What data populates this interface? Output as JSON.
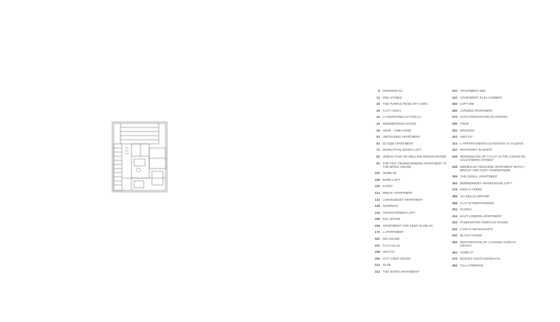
{
  "left_column": [
    {
      "page": "8",
      "title": "INTERIOR D2"
    },
    {
      "page": "12",
      "title": "MINI STUDIO"
    },
    {
      "page": "20",
      "title": "THE PURPLE ROSE OF CAIRO"
    },
    {
      "page": "28",
      "title": "FLAT 710N-1"
    },
    {
      "page": "34",
      "title": "LA MANSARDA DI STELLA"
    },
    {
      "page": "40",
      "title": "SHERBROOKE HOUSE"
    },
    {
      "page": "46",
      "title": "H8AR – ONE HOME"
    },
    {
      "page": "54",
      "title": "UNFOLDING APARTMENT"
    },
    {
      "page": "64",
      "title": "40 SQM APARTMENT"
    },
    {
      "page": "72",
      "title": "MANHATTAN MICRO LOFT"
    },
    {
      "page": "82",
      "title": "URBAN TAKE ON MELLOW MONOCHROME"
    },
    {
      "page": "92",
      "title": "THE TINY TRANSFORMING APARTMENT IN THE BRICK HOUSE"
    },
    {
      "page": "100",
      "title": "HOME 08"
    },
    {
      "page": "108",
      "title": "BARN LOFT"
    },
    {
      "page": "118",
      "title": "G-ROC"
    },
    {
      "page": "124",
      "title": "BREAK APARTMENT"
    },
    {
      "page": "132",
      "title": "LOW-BUDGET APARTMENT"
    },
    {
      "page": "138",
      "title": "SOSPESO"
    },
    {
      "page": "144",
      "title": "TRANSFORMER LOFT"
    },
    {
      "page": "158",
      "title": "SAL HOUSE"
    },
    {
      "page": "166",
      "title": "APARTMENT FOR RENT IN MILAN"
    },
    {
      "page": "176",
      "title": "L APARTMENT"
    },
    {
      "page": "182",
      "title": "IES HOUSE"
    },
    {
      "page": "190",
      "title": "FLAT VILAS"
    },
    {
      "page": "198",
      "title": "UNIT #2"
    },
    {
      "page": "206",
      "title": "CITY VIEW HOUSE"
    },
    {
      "page": "214",
      "title": "SLAB"
    },
    {
      "page": "224",
      "title": "THE WHITE APARTMENT"
    }
  ],
  "right_column": [
    {
      "page": "234",
      "title": "APARTMENT-26D"
    },
    {
      "page": "242",
      "title": "APARTMENT IN EL CARMEN"
    },
    {
      "page": "250",
      "title": "LOFT MM"
    },
    {
      "page": "260",
      "title": "JARDINS APARTMENT"
    },
    {
      "page": "270",
      "title": "ATTIC RENOVATION IN VERONA"
    },
    {
      "page": "280",
      "title": "FÖHR"
    },
    {
      "page": "294",
      "title": "EROSION"
    },
    {
      "page": "304",
      "title": "SWITCH"
    },
    {
      "page": "314",
      "title": "L'APPARTAMENTO DI MARTINA E VALERIO"
    },
    {
      "page": "322",
      "title": "RHAPSODY IN WHITE"
    },
    {
      "page": "338",
      "title": "REMODELING OF A FLAT IN THE COMTE DE SALVATIERRA STREET"
    },
    {
      "page": "348",
      "title": "MINIMALIST MOSCOW APARTMENT WITH A BRIGHT AND COZY ATMOSPHERE"
    },
    {
      "page": "356",
      "title": "THE OXHILL APARTMENT"
    },
    {
      "page": "364",
      "title": "BERMONDSEY WAREHOUSE LOFT"
    },
    {
      "page": "376",
      "title": "PIED-À-TERRE"
    },
    {
      "page": "388",
      "title": "VIA DELLE ORFANE"
    },
    {
      "page": "398",
      "title": "FLAT IN MONTEVERDE"
    },
    {
      "page": "404",
      "title": "GLORIA"
    },
    {
      "page": "414",
      "title": "EAST LONDON APARTMENT"
    },
    {
      "page": "424",
      "title": "PADDINGTON TERRACE HOUSE"
    },
    {
      "page": "432",
      "title": "CASA CAMAGHIAHO'S"
    },
    {
      "page": "442",
      "title": "BLACK HOUSE"
    },
    {
      "page": "454",
      "title": "RESTORATION OF A HOUSE-YARD IN GRACIA"
    },
    {
      "page": "464",
      "title": "HOME 07"
    },
    {
      "page": "476",
      "title": "DUPLEX SANTA ENGRACIA"
    },
    {
      "page": "482",
      "title": "VILLA PERRINS"
    }
  ]
}
